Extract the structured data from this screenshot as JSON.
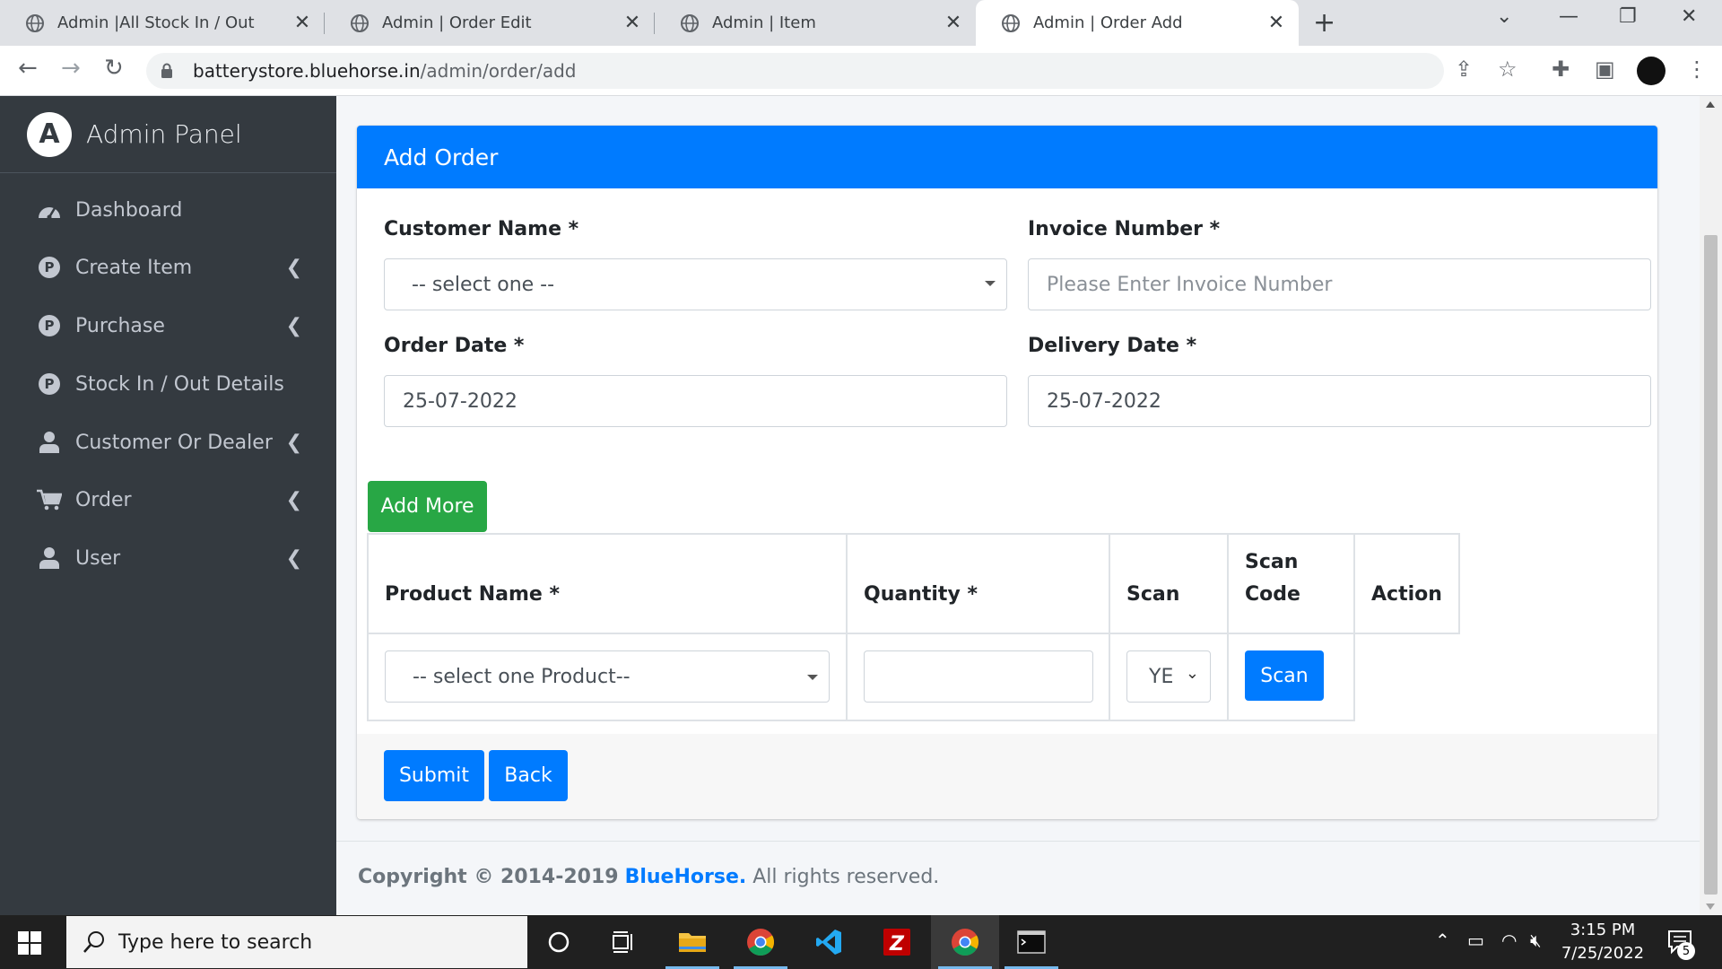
{
  "browser": {
    "tabs": [
      {
        "title": "Admin |All Stock In / Out",
        "active": false
      },
      {
        "title": "Admin | Order Edit",
        "active": false
      },
      {
        "title": "Admin | Item",
        "active": false
      },
      {
        "title": "Admin | Order Add",
        "active": true
      }
    ],
    "url_host": "batterystore.bluehorse.in",
    "url_path": "/admin/order/add"
  },
  "sidebar": {
    "brand": "Admin Panel",
    "brand_logo": "A",
    "items": [
      {
        "label": "Dashboard",
        "icon": "dashboard-icon",
        "has_submenu": false
      },
      {
        "label": "Create Item",
        "icon": "p-circle-icon",
        "has_submenu": true
      },
      {
        "label": "Purchase",
        "icon": "p-circle-icon",
        "has_submenu": true
      },
      {
        "label": "Stock In / Out Details",
        "icon": "p-circle-icon",
        "has_submenu": false
      },
      {
        "label": "Customer Or Dealer",
        "icon": "user-icon",
        "has_submenu": true
      },
      {
        "label": "Order",
        "icon": "cart-icon",
        "has_submenu": true
      },
      {
        "label": "User",
        "icon": "user-icon",
        "has_submenu": true
      }
    ]
  },
  "form": {
    "title": "Add Order",
    "customer_name_label": "Customer Name *",
    "customer_name_value": "-- select one --",
    "invoice_number_label": "Invoice Number *",
    "invoice_number_placeholder": "Please Enter Invoice Number",
    "order_date_label": "Order Date *",
    "order_date_value": "25-07-2022",
    "delivery_date_label": "Delivery Date *",
    "delivery_date_value": "25-07-2022",
    "add_more_label": "Add More",
    "table": {
      "headers": [
        "Product Name *",
        "Quantity *",
        "Scan",
        "Scan Code",
        "Action"
      ],
      "row": {
        "product_value": "-- select one Product--",
        "quantity_value": "",
        "scan_value": "YE",
        "scan_button": "Scan"
      }
    },
    "submit_label": "Submit",
    "back_label": "Back"
  },
  "footer": {
    "prefix": "Copyright © 2014-2019",
    "brand": "BlueHorse.",
    "suffix": "All rights reserved."
  },
  "taskbar": {
    "search_placeholder": "Type here to search",
    "time": "3:15 PM",
    "date": "7/25/2022",
    "notifications": "5"
  },
  "colors": {
    "primary": "#007bff",
    "success": "#28a745",
    "sidebar_bg": "#343a40"
  }
}
